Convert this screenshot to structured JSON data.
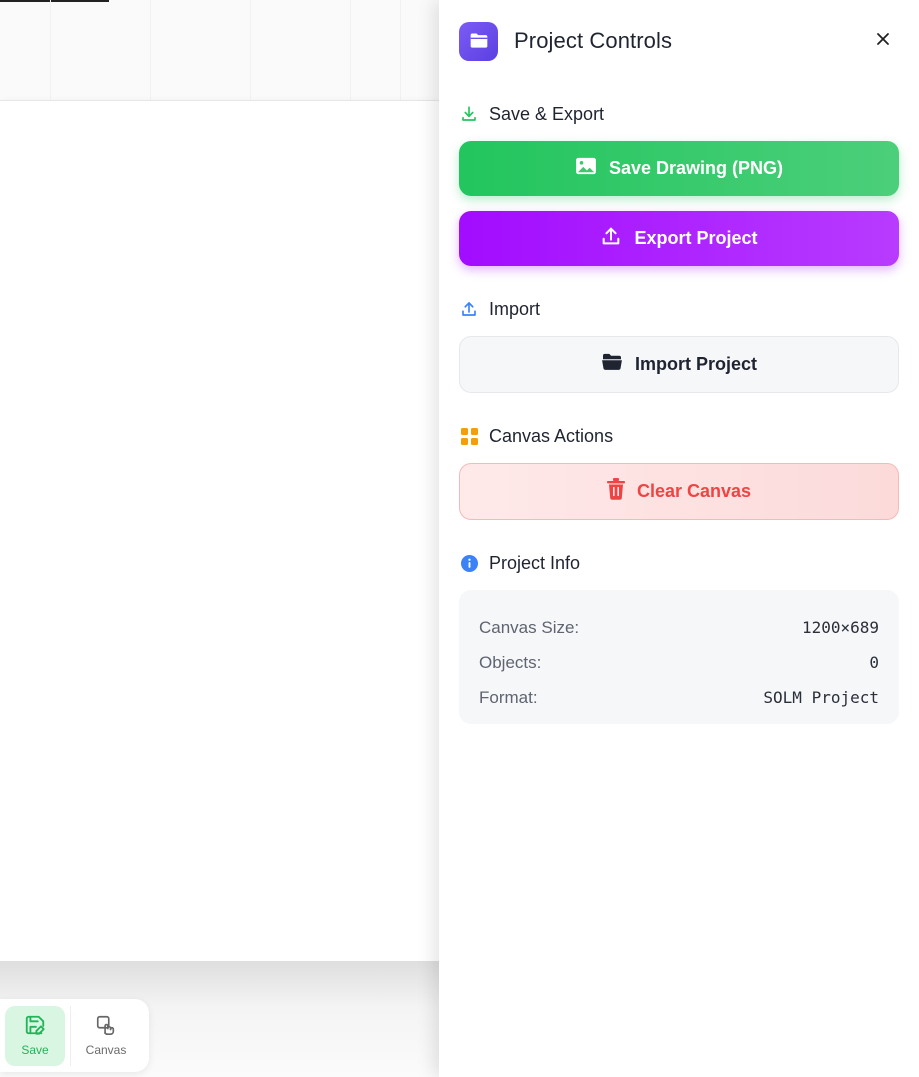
{
  "panel": {
    "title": "Project Controls",
    "sections": {
      "save_export": {
        "label": "Save & Export",
        "save_drawing_label": "Save Drawing (PNG)",
        "export_project_label": "Export Project"
      },
      "import": {
        "label": "Import",
        "import_project_label": "Import Project"
      },
      "canvas_actions": {
        "label": "Canvas Actions",
        "clear_canvas_label": "Clear Canvas"
      },
      "project_info": {
        "label": "Project Info",
        "rows": [
          {
            "key": "Canvas Size:",
            "value": "1200×689"
          },
          {
            "key": "Objects:",
            "value": "0"
          },
          {
            "key": "Format:",
            "value": "SOLM Project"
          }
        ]
      }
    }
  },
  "toolbar": {
    "save_label": "Save",
    "canvas_label": "Canvas"
  },
  "icons": {
    "header": "folder-icon",
    "close": "close-icon",
    "save_export": "download-icon",
    "save_drawing": "image-icon",
    "export_project": "upload-icon",
    "import": "upload-icon",
    "import_project": "folder-open-icon",
    "canvas_actions": "grid-icon",
    "clear_canvas": "trash-icon",
    "project_info": "info-icon",
    "toolbar_save": "save-edit-icon",
    "toolbar_canvas": "hand-pointer-icon"
  },
  "colors": {
    "accent_purple": "#7c5cf6",
    "save_green": "#22c55e",
    "export_purple": "#a20cff",
    "danger_red": "#ef4444",
    "info_blue": "#3b82f6",
    "canvas_orange": "#f59e0b"
  }
}
